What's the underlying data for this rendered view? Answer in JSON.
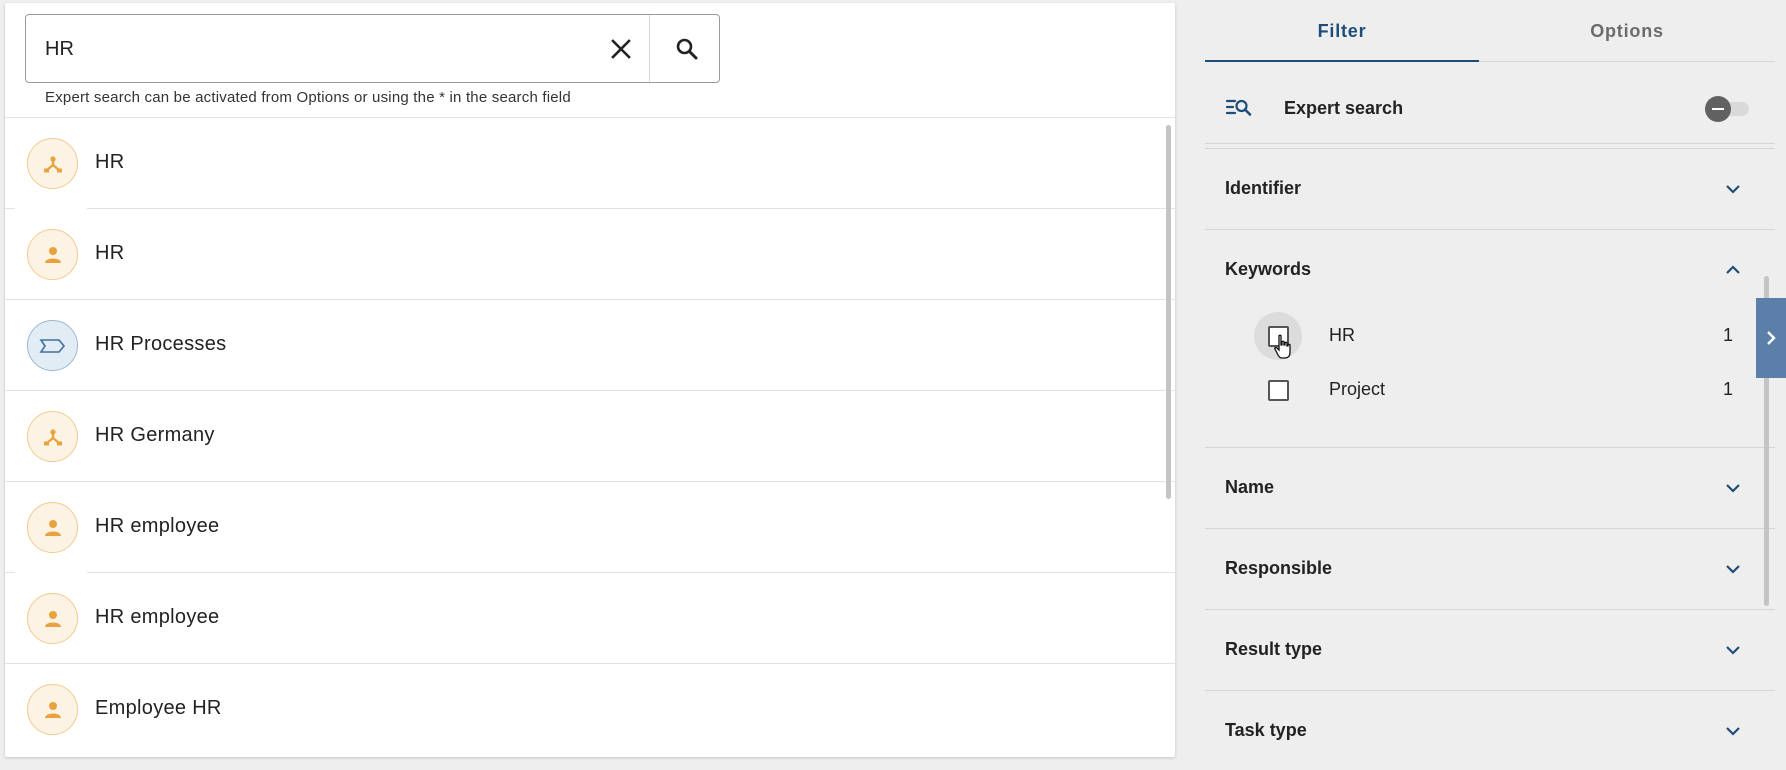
{
  "search": {
    "value": "HR",
    "hint": "Expert search can be activated from Options or using the * in the search field"
  },
  "results": [
    {
      "label": "HR",
      "icon": "org-unit-icon",
      "color": "orange"
    },
    {
      "label": "HR",
      "icon": "person-icon",
      "color": "orange"
    },
    {
      "label": "HR Processes",
      "icon": "process-icon",
      "color": "blue"
    },
    {
      "label": "HR Germany",
      "icon": "org-unit-icon",
      "color": "orange"
    },
    {
      "label": "HR employee",
      "icon": "person-icon",
      "color": "orange"
    },
    {
      "label": "HR employee",
      "icon": "person-icon",
      "color": "orange"
    },
    {
      "label": "Employee HR",
      "icon": "person-icon",
      "color": "orange"
    }
  ],
  "tabs": {
    "filter": "Filter",
    "options": "Options"
  },
  "expert_search": {
    "label": "Expert search",
    "enabled": false
  },
  "sections": {
    "identifier": "Identifier",
    "keywords": "Keywords",
    "name": "Name",
    "responsible": "Responsible",
    "result_type": "Result type",
    "task_type": "Task type"
  },
  "keywords": [
    {
      "label": "HR",
      "count": "1",
      "checked": false
    },
    {
      "label": "Project",
      "count": "1",
      "checked": false
    }
  ],
  "colors": {
    "accent": "#1e4d7a",
    "orange_icon": "#e8a33d",
    "blue_icon": "#3f6f9c",
    "side_handle": "#5b7fa8"
  }
}
